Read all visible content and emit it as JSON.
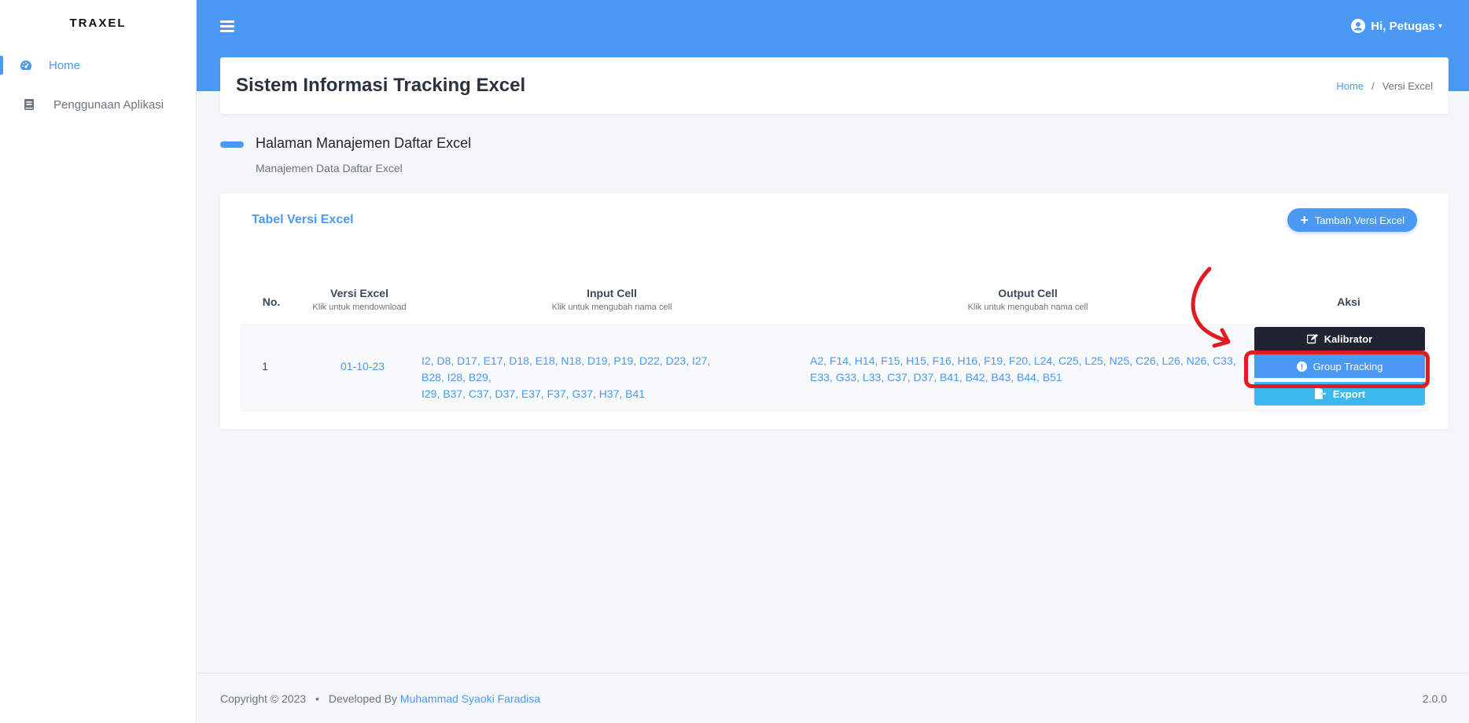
{
  "sidebar": {
    "brand": "TRAXEL",
    "items": [
      {
        "label": "Home",
        "icon": "dashboard-icon",
        "active": true
      },
      {
        "label": "Penggunaan Aplikasi",
        "icon": "book-icon",
        "active": false
      }
    ]
  },
  "header": {
    "user_greeting": "Hi, Petugas",
    "icon_user": "user-circle-icon",
    "icon_menu": "hamburger-icon"
  },
  "page": {
    "title": "Sistem Informasi Tracking Excel",
    "breadcrumb": {
      "home": "Home",
      "separator": "/",
      "current": "Versi Excel"
    }
  },
  "section": {
    "title": "Halaman Manajemen Daftar Excel",
    "subtitle": "Manajemen Data Daftar Excel"
  },
  "table": {
    "title": "Tabel Versi Excel",
    "add_button": "Tambah Versi Excel",
    "columns": [
      {
        "header": "No.",
        "sub": ""
      },
      {
        "header": "Versi Excel",
        "sub": "Klik untuk mendownload"
      },
      {
        "header": "Input Cell",
        "sub": "Klik untuk mengubah nama cell"
      },
      {
        "header": "Output Cell",
        "sub": "Klik untuk mengubah nama cell"
      },
      {
        "header": "Aksi",
        "sub": ""
      }
    ],
    "rows": [
      {
        "no": "1",
        "versi": "01-10-23",
        "input_line1": "I2, D8, D17, E17, D18, E18, N18, D19, P19, D22, D23, I27, B28, I28, B29,",
        "input_line2": "I29, B37, C37, D37, E37, F37, G37, H37, B41",
        "output_line1": "A2, F14, H14, F15, H15, F16, H16, F19, F20, L24, C25, L25, N25, C26, L26, N26, C33,",
        "output_line2": "E33, G33, L33, C37, D37, B41, B42, B43, B44, B51",
        "actions": {
          "kalibrator": "Kalibrator",
          "group_tracking": "Group Tracking",
          "export": "Export"
        }
      }
    ]
  },
  "footer": {
    "copyright": "Copyright © 2023",
    "separator": "•",
    "developed_by": "Developed By",
    "developer": "Muhammad Syaoki Faradisa",
    "version": "2.0.0"
  },
  "colors": {
    "primary": "#4a9af5",
    "dark": "#1f2430",
    "info": "#3bb8ec",
    "annotation": "#e21b22"
  }
}
